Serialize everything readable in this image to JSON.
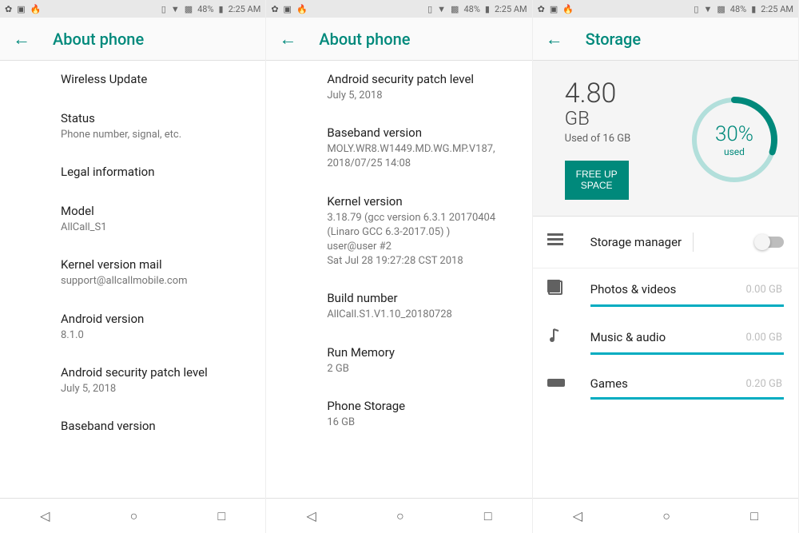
{
  "statusbar": {
    "battery_pct": "48%",
    "time": "2:25 AM"
  },
  "panels": [
    {
      "title": "About phone",
      "items": [
        {
          "title": "Wireless Update",
          "subtitle": ""
        },
        {
          "title": "Status",
          "subtitle": "Phone number, signal, etc."
        },
        {
          "title": "Legal information",
          "subtitle": ""
        },
        {
          "title": "Model",
          "subtitle": "AllCall_S1"
        },
        {
          "title": "Kernel version mail",
          "subtitle": "support@allcallmobile.com"
        },
        {
          "title": "Android version",
          "subtitle": "8.1.0"
        },
        {
          "title": "Android security patch level",
          "subtitle": "July 5, 2018"
        },
        {
          "title": "Baseband version",
          "subtitle": ""
        }
      ]
    },
    {
      "title": "About phone",
      "items": [
        {
          "title": "Android security patch level",
          "subtitle": "July 5, 2018"
        },
        {
          "title": "Baseband version",
          "subtitle": "MOLY.WR8.W1449.MD.WG.MP.V187, 2018/07/25 14:08"
        },
        {
          "title": "Kernel version",
          "subtitle": "3.18.79 (gcc version 6.3.1 20170404 (Linaro GCC 6.3-2017.05) )\nuser@user #2\nSat Jul 28 19:27:28 CST 2018"
        },
        {
          "title": "Build number",
          "subtitle": "AllCall.S1.V1.10_20180728"
        },
        {
          "title": "Run Memory",
          "subtitle": "2 GB"
        },
        {
          "title": "Phone Storage",
          "subtitle": "16 GB"
        }
      ]
    }
  ],
  "storage": {
    "title": "Storage",
    "used_value": "4.80",
    "used_unit": "GB",
    "used_of": "Used of 16 GB",
    "percent_text": "30%",
    "percent_label": "used",
    "percent_frac": 0.3,
    "freeup_label": "FREE UP\nSPACE",
    "manager_label": "Storage manager",
    "categories": [
      {
        "name": "Photos & videos",
        "size": "0.00 GB",
        "icon": "photos"
      },
      {
        "name": "Music & audio",
        "size": "0.00 GB",
        "icon": "music"
      },
      {
        "name": "Games",
        "size": "0.20 GB",
        "icon": "games"
      }
    ]
  }
}
